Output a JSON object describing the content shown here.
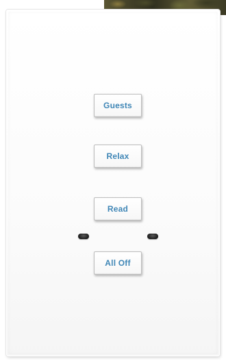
{
  "keypad": {
    "buttons": [
      {
        "label": "Guests"
      },
      {
        "label": "Relax"
      },
      {
        "label": "Read"
      },
      {
        "label": "All Off"
      }
    ]
  },
  "colors": {
    "label_blue": "#3f86b6",
    "plate": "#ffffff"
  },
  "icons": [
    "led-indicator-icon",
    "led-indicator-icon"
  ]
}
